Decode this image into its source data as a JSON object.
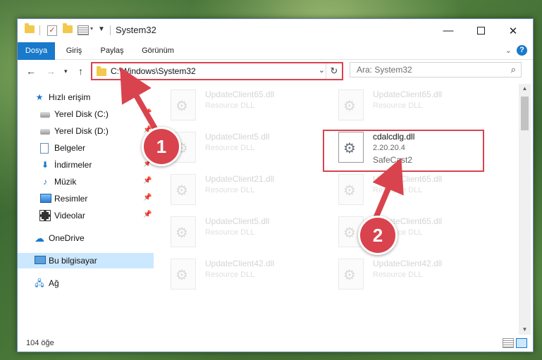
{
  "window": {
    "title": "System32"
  },
  "ribbon": {
    "tabs": [
      "Dosya",
      "Giriş",
      "Paylaş",
      "Görünüm"
    ],
    "accent": "#1979ca"
  },
  "address": {
    "path": "C:\\Windows\\System32"
  },
  "search": {
    "placeholder": "Ara: System32"
  },
  "nav": {
    "items": [
      {
        "label": "Hızlı erişim",
        "icon": "star-icon"
      },
      {
        "label": "Yerel Disk (C:)",
        "icon": "disk-icon"
      },
      {
        "label": "Yerel Disk (D:)",
        "icon": "disk-icon"
      },
      {
        "label": "Belgeler",
        "icon": "documents-icon"
      },
      {
        "label": "İndirmeler",
        "icon": "download-icon"
      },
      {
        "label": "Müzik",
        "icon": "music-icon"
      },
      {
        "label": "Resimler",
        "icon": "pictures-icon"
      },
      {
        "label": "Videolar",
        "icon": "videos-icon"
      },
      {
        "label": "OneDrive",
        "icon": "cloud-icon"
      },
      {
        "label": "Bu bilgisayar",
        "icon": "computer-icon"
      },
      {
        "label": "Ağ",
        "icon": "network-icon"
      }
    ]
  },
  "files": {
    "left": [
      {
        "name": "UpdateClient65.dll",
        "type": "Resource DLL"
      },
      {
        "name": "UpdateClient5.dll",
        "type": "Resource DLL"
      },
      {
        "name": "UpdateClient21.dll",
        "type": "Resource DLL"
      },
      {
        "name": "UpdateClient5.dll",
        "type": "Resource DLL"
      },
      {
        "name": "UpdateClient42.dll",
        "type": "Resource DLL"
      }
    ],
    "right": [
      {
        "name": "UpdateClient65.dll",
        "type": "Resource DLL"
      },
      {
        "name": "UpdateClient65.dll",
        "type": "Resource DLL"
      },
      {
        "name": "UpdateClient65.dll",
        "type": "Resource DLL"
      },
      {
        "name": "UpdateClient42.dll",
        "type": "Resource DLL"
      }
    ],
    "highlight": {
      "name": "cdalcdlg.dll",
      "version": "2.20.20.4",
      "company": "SafeCast2"
    }
  },
  "status": {
    "count": "104 öğe"
  },
  "annotations": {
    "badge1": "1",
    "badge2": "2",
    "color": "#d9434e"
  }
}
